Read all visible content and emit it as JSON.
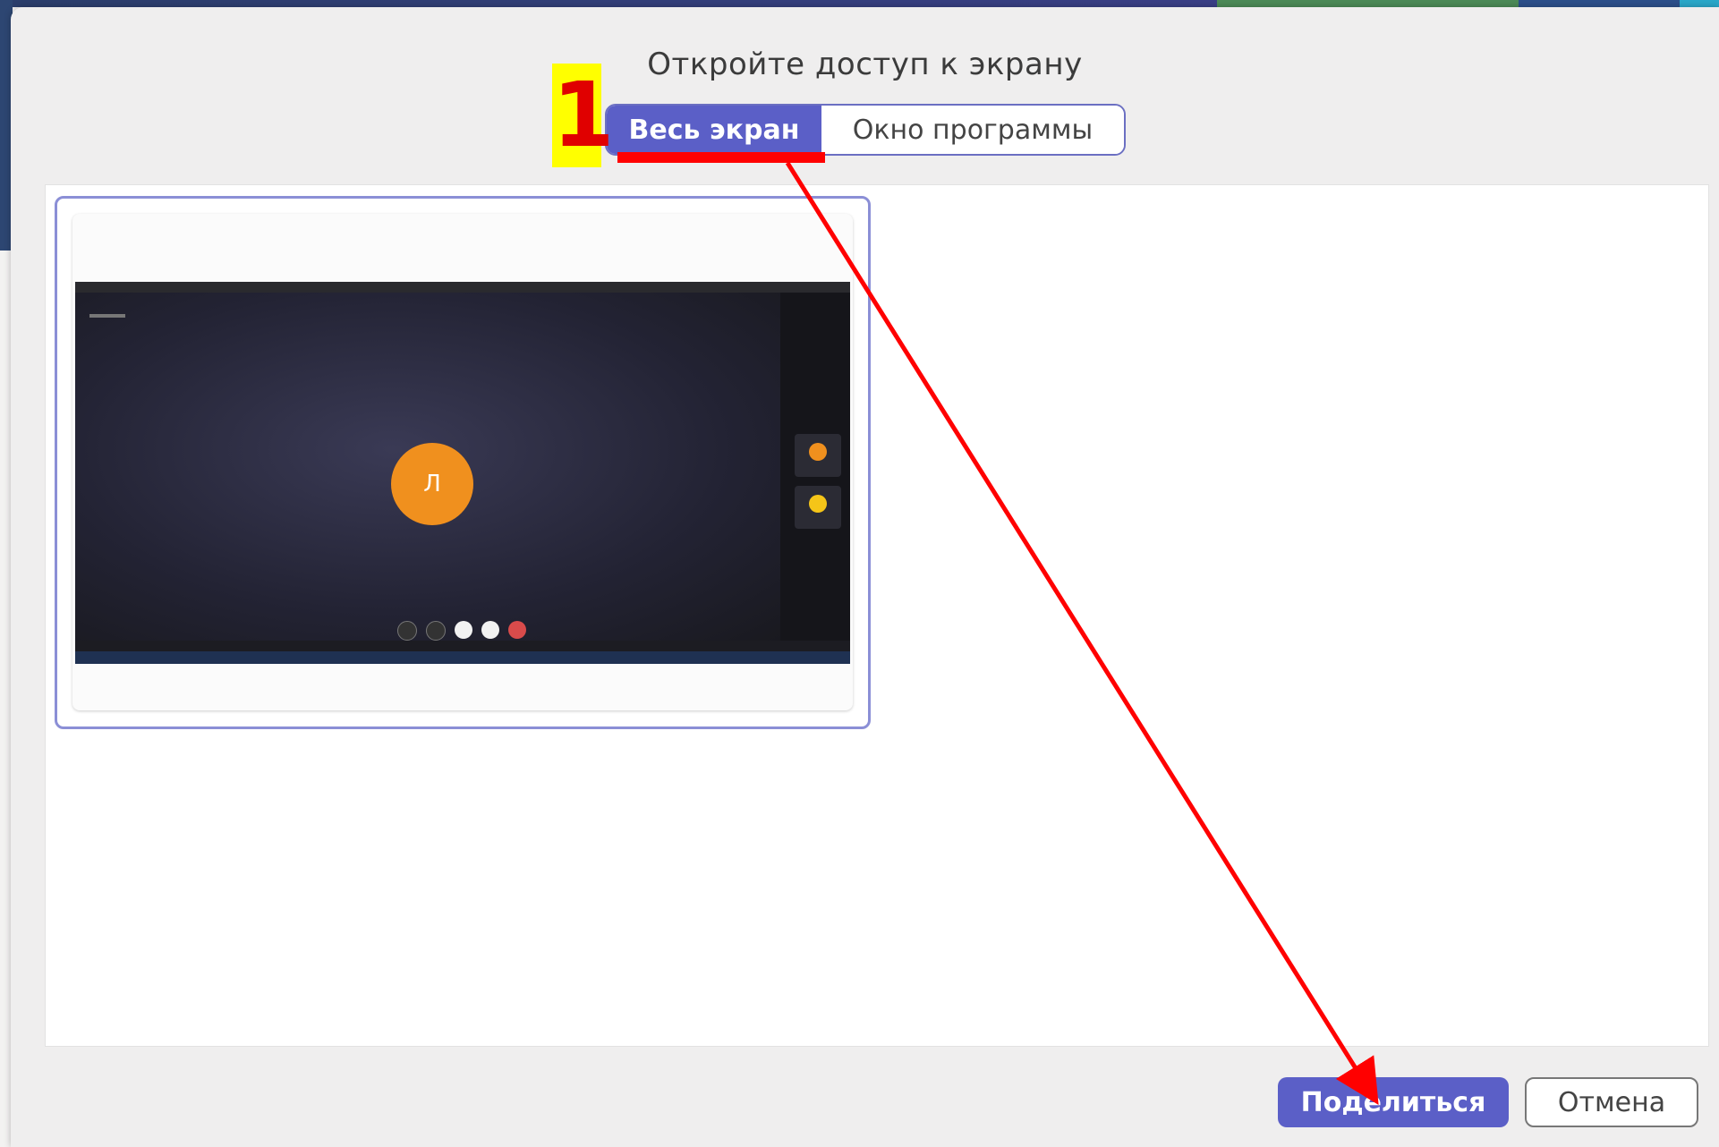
{
  "dialog": {
    "title": "Откройте доступ к экрану",
    "tabs": [
      {
        "label": "Весь экран",
        "selected": true
      },
      {
        "label": "Окно программы",
        "selected": false
      }
    ],
    "preview": {
      "avatar_initial": "Л"
    },
    "buttons": {
      "share_label": "Поделиться",
      "cancel_label": "Отмена"
    }
  },
  "annotation": {
    "step_number": "1",
    "color": "#ff0000",
    "badge_color": "#ffff00"
  },
  "colors": {
    "accent": "#5b5fc7",
    "dialog_bg": "#efeeee",
    "avatar": "#f0901e"
  }
}
